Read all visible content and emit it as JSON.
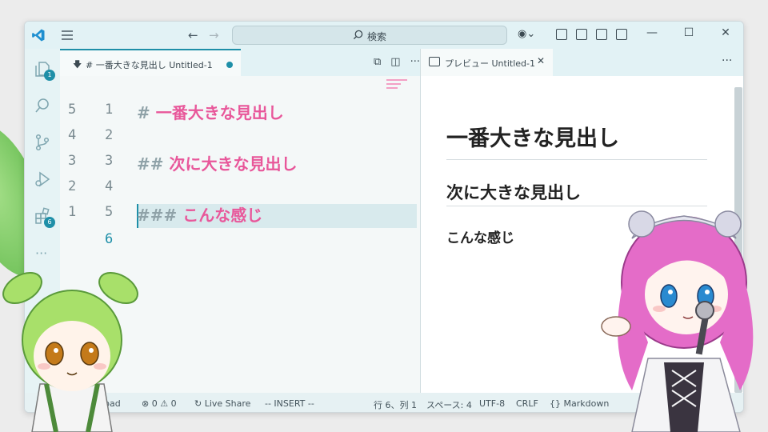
{
  "titlebar": {
    "search_placeholder": "検索",
    "minimize": "—",
    "maximize": "☐",
    "close": "✕"
  },
  "activity_bar": {
    "explorer_badge": "1",
    "extensions_badge": "6",
    "more": "···"
  },
  "editor_tab": {
    "label": "# 一番大きな見出し Untitled-1"
  },
  "editor": {
    "lines": [
      {
        "rel": "5",
        "abs": "1",
        "hash": "#",
        "text": "一番大きな見出し"
      },
      {
        "rel": "4",
        "abs": "2",
        "hash": "",
        "text": ""
      },
      {
        "rel": "3",
        "abs": "3",
        "hash": "##",
        "text": "次に大きな見出し"
      },
      {
        "rel": "2",
        "abs": "4",
        "hash": "",
        "text": ""
      },
      {
        "rel": "1",
        "abs": "5",
        "hash": "###",
        "text": "こんな感じ"
      },
      {
        "rel": "",
        "abs": "6",
        "hash": "",
        "text": ""
      }
    ]
  },
  "preview_tab": {
    "label": "プレビュー Untitled-1"
  },
  "preview": {
    "h1": "一番大きな見出し",
    "h2": "次に大きな見出し",
    "h3": "こんな感じ"
  },
  "status_bar": {
    "left_partial": "hpad",
    "problems": "⊗ 0 ⚠ 0",
    "live_share": "Live Share",
    "mode": "-- INSERT --",
    "position": "行 6、列 1",
    "indent": "スペース: 4",
    "encoding": "UTF-8",
    "eol": "CRLF",
    "language": "Markdown"
  },
  "colors": {
    "accent": "#1e8fa8",
    "markdown_heading": "#e8579a",
    "titlebar_bg": "#e2f2f5"
  }
}
